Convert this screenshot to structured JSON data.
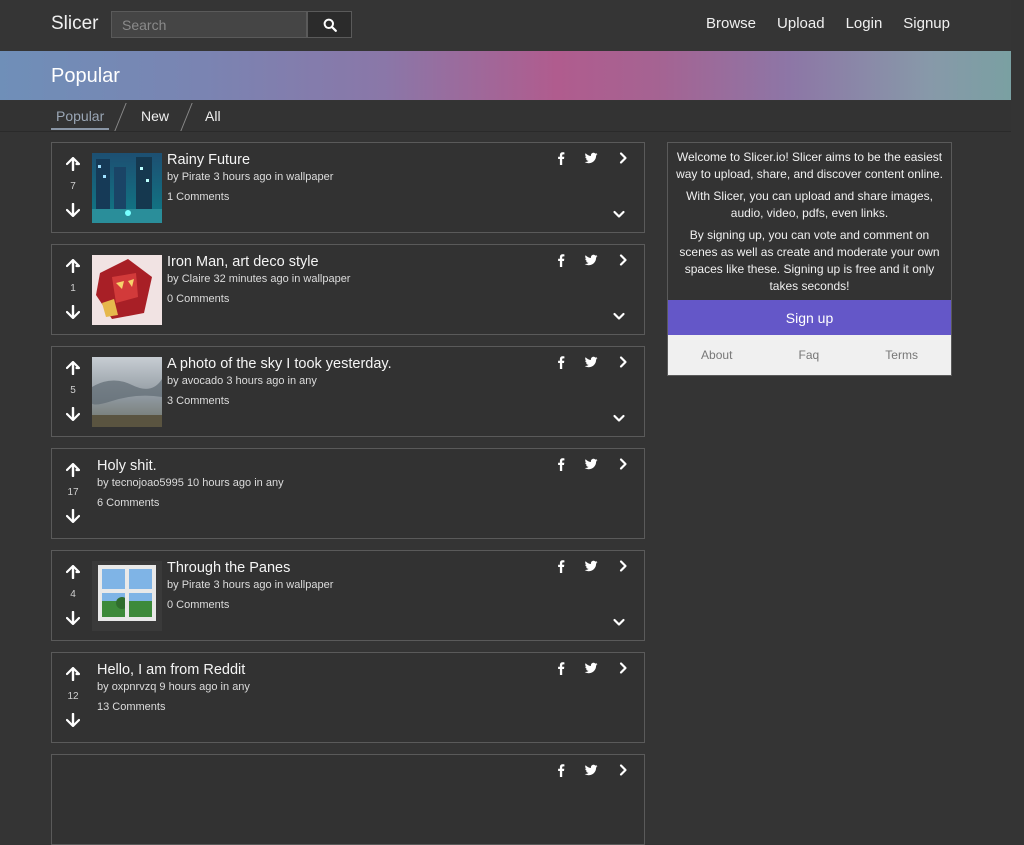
{
  "nav": {
    "brand": "Slicer",
    "search_placeholder": "Search",
    "links": [
      "Browse",
      "Upload",
      "Login",
      "Signup"
    ]
  },
  "banner": {
    "title": "Popular"
  },
  "tabs": [
    "Popular",
    "New",
    "All"
  ],
  "posts": [
    {
      "title": "Rainy Future",
      "author": "Pirate",
      "time": "3 hours ago",
      "space": "wallpaper",
      "score": "7",
      "comments": "1 Comments",
      "thumb": "city-rain"
    },
    {
      "title": "Iron Man, art deco style",
      "author": "Claire",
      "time": "32 minutes ago",
      "space": "wallpaper",
      "score": "1",
      "comments": "0 Comments",
      "thumb": "ironman"
    },
    {
      "title": "A photo of the sky I took yesterday.",
      "author": "avocado",
      "time": "3 hours ago",
      "space": "any",
      "score": "5",
      "comments": "3 Comments",
      "thumb": "sky"
    },
    {
      "title": "Holy shit.",
      "author": "tecnojoao5995",
      "time": "10 hours ago",
      "space": "any",
      "score": "17",
      "comments": "6 Comments",
      "thumb": ""
    },
    {
      "title": "Through the Panes",
      "author": "Pirate",
      "time": "3 hours ago",
      "space": "wallpaper",
      "score": "4",
      "comments": "0 Comments",
      "thumb": "window"
    },
    {
      "title": "Hello, I am from Reddit",
      "author": "oxpnrvzq",
      "time": "9 hours ago",
      "space": "any",
      "score": "12",
      "comments": "13 Comments",
      "thumb": ""
    }
  ],
  "sidebar": {
    "paragraphs": [
      "Welcome to Slicer.io! Slicer aims to be the easiest way to upload, share, and discover content online.",
      "With Slicer, you can upload and share images, audio, video, pdfs, even links.",
      "By signing up, you can vote and comment on scenes as well as create and moderate your own spaces like these. Signing up is free and it only takes seconds!"
    ],
    "signup_label": "Sign up",
    "footer_links": [
      "About",
      "Faq",
      "Terms"
    ]
  },
  "icons": {
    "search": "search-icon",
    "upvote": "arrow-up-icon",
    "downvote": "arrow-down-icon",
    "facebook": "facebook-icon",
    "twitter": "twitter-icon",
    "more": "chevron-right-icon",
    "expand": "chevron-down-icon"
  }
}
